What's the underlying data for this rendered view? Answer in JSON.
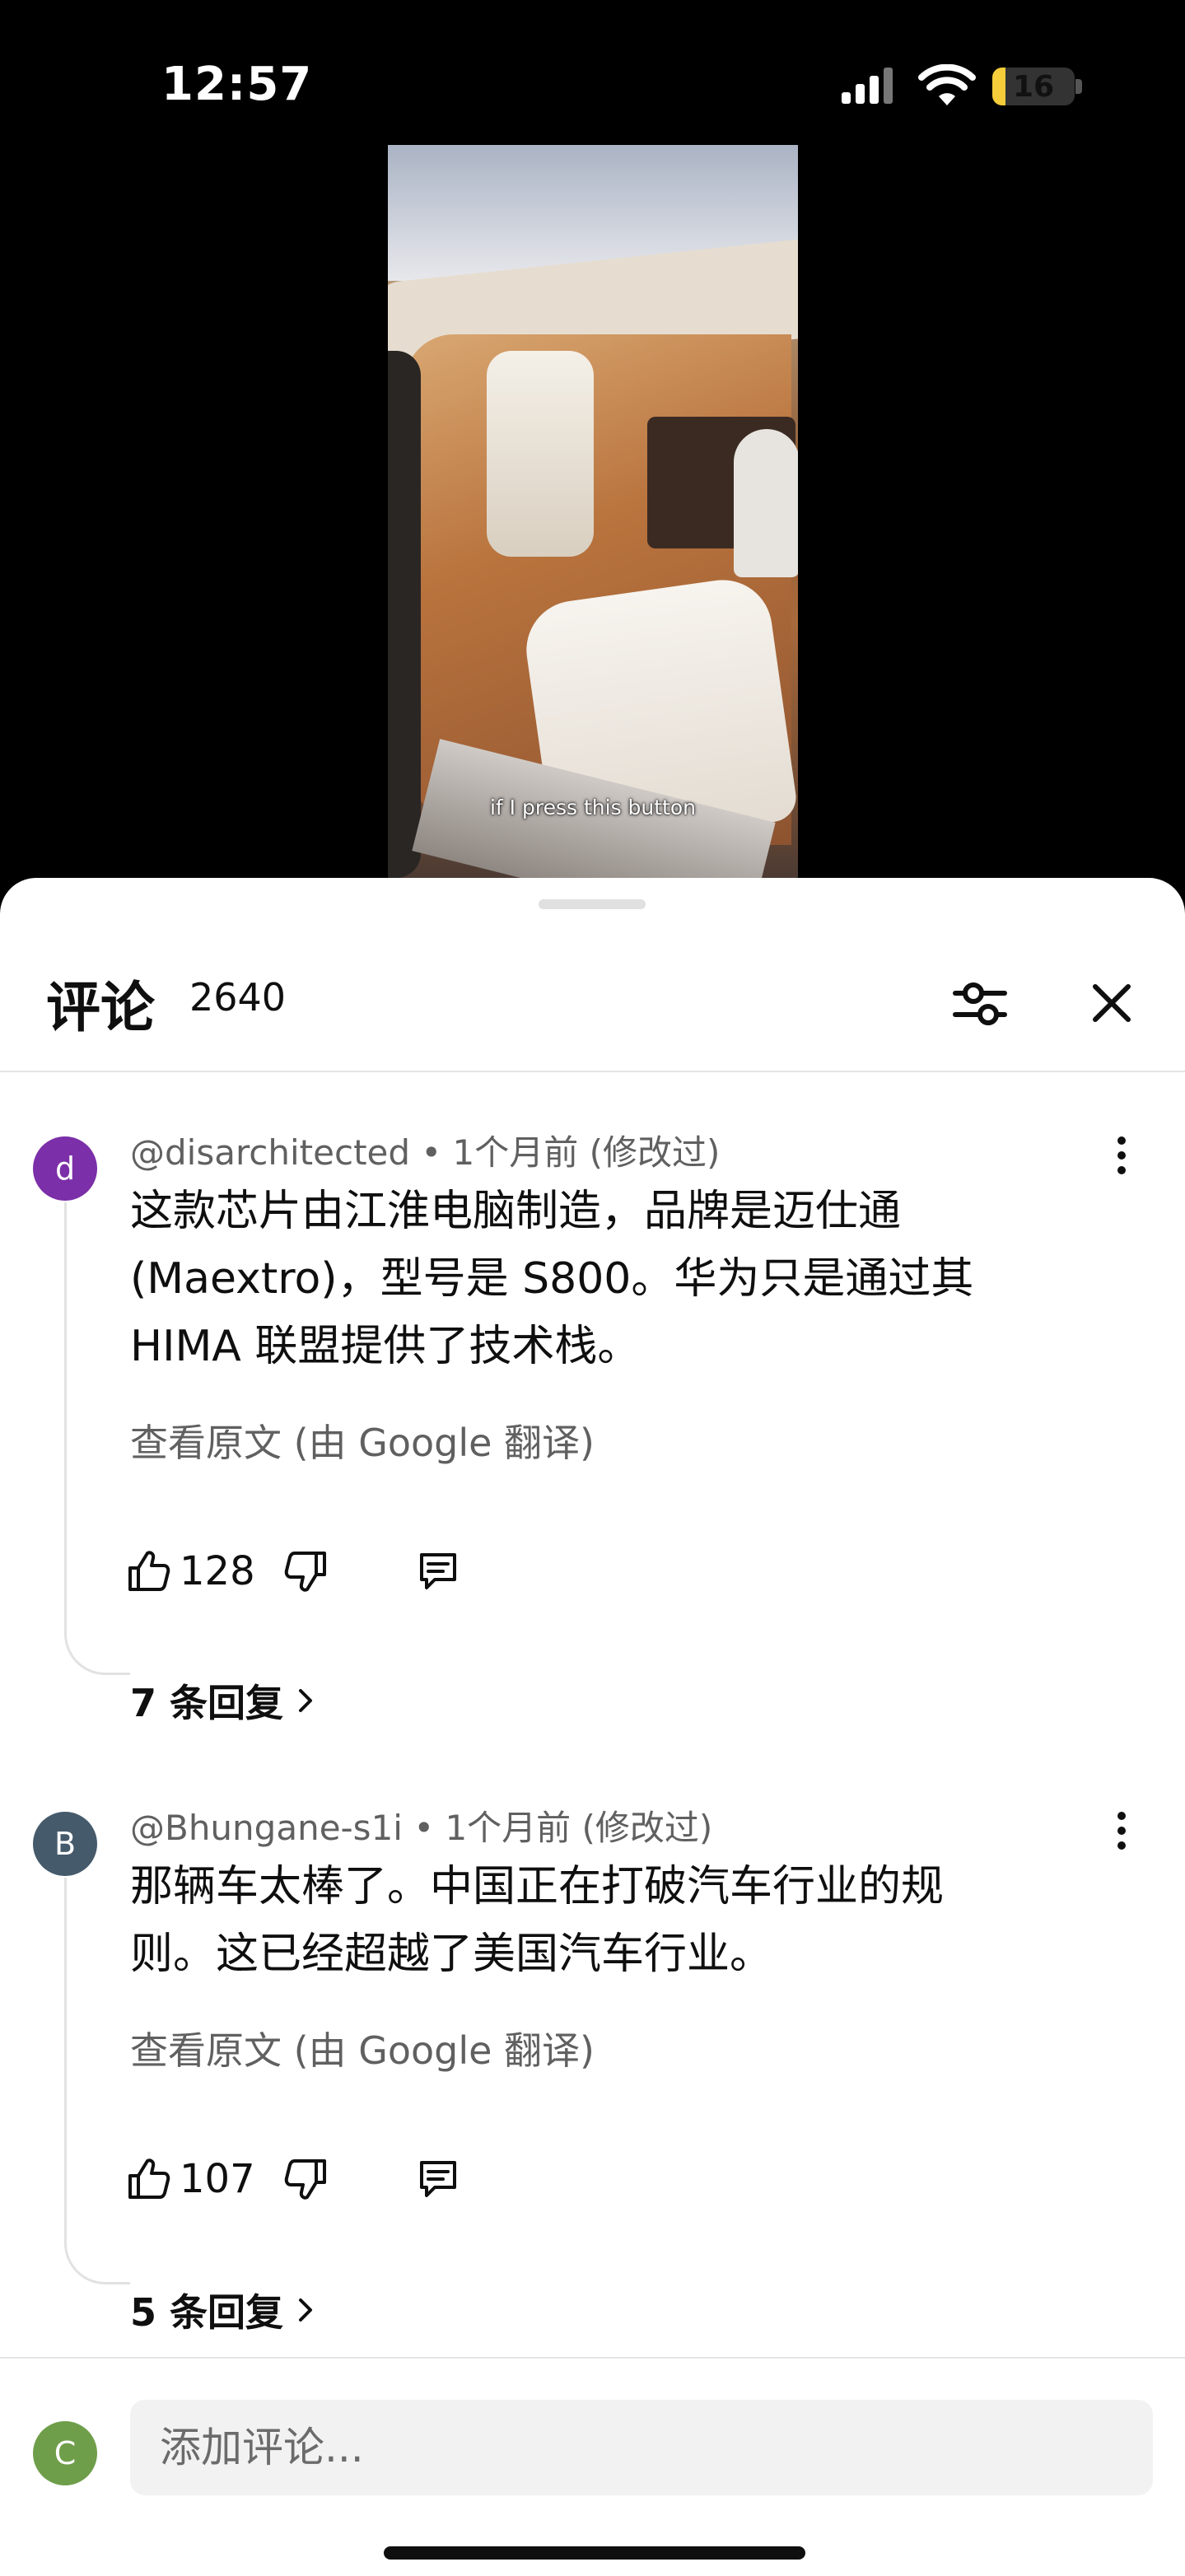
{
  "status": {
    "time": "12:57",
    "battery": "16",
    "battery_level": 0.16
  },
  "video": {
    "caption": "if I press this button"
  },
  "header": {
    "title": "评论",
    "count": "2640"
  },
  "comments": [
    {
      "avatar_letter": "d",
      "avatar_color": "#7b2fa8",
      "author": "@disarchitected",
      "time": "1个月前",
      "edited": "(修改过)",
      "lines": [
        "这款芯片由江淮电脑制造，品牌是迈仕通",
        "(Maextro)，型号是 S800。华为只是通过其",
        "HIMA 联盟提供了技术栈。"
      ],
      "translate": "查看原文 (由 Google 翻译)",
      "likes": "128",
      "replies": "7 条回复"
    },
    {
      "avatar_letter": "B",
      "avatar_color": "#455a6b",
      "author": "@Bhungane-s1i",
      "time": "1个月前",
      "edited": "(修改过)",
      "lines": [
        "那辆车太棒了。中国正在打破汽车行业的规",
        "则。这已经超越了美国汽车行业。"
      ],
      "translate": "查看原文 (由 Google 翻译)",
      "likes": "107",
      "replies": "5 条回复"
    }
  ],
  "composer": {
    "avatar_letter": "C",
    "avatar_color": "#6f9e4a",
    "placeholder": "添加评论..."
  },
  "icons": [
    "signal-icon",
    "wifi-icon",
    "battery-icon",
    "filter-icon",
    "close-icon",
    "more-vert-icon",
    "thumb-up-icon",
    "thumb-down-icon",
    "comment-reply-icon",
    "chevron-right-icon"
  ]
}
